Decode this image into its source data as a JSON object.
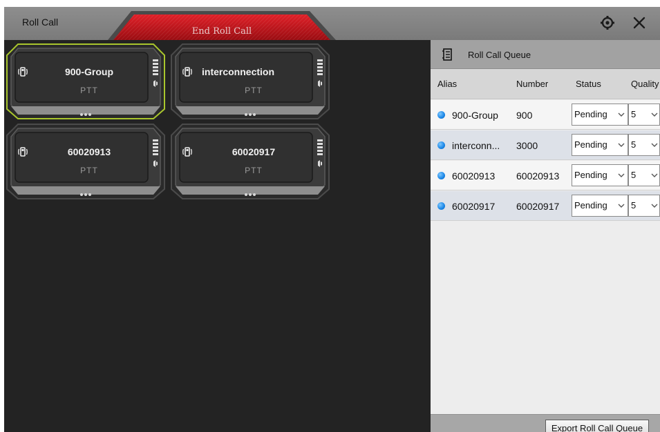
{
  "window": {
    "title": "Roll Call",
    "end_button_label": "End Roll Call",
    "settings_icon": "settings-gear-icon",
    "close_icon": "close-icon"
  },
  "cards": [
    {
      "name": "900-Group",
      "type": "PTT",
      "selected": true,
      "icon": "walkie-talkie-icon"
    },
    {
      "name": "interconnection",
      "type": "PTT",
      "selected": false,
      "icon": "walkie-talkie-icon"
    },
    {
      "name": "60020913",
      "type": "PTT",
      "selected": false,
      "icon": "walkie-talkie-icon"
    },
    {
      "name": "60020917",
      "type": "PTT",
      "selected": false,
      "icon": "walkie-talkie-icon"
    }
  ],
  "queue": {
    "title": "Roll Call Queue",
    "icon": "list-icon",
    "columns": [
      "Alias",
      "Number",
      "Status",
      "Quality"
    ],
    "rows": [
      {
        "alias": "900-Group",
        "number": "900",
        "status": "Pending",
        "quality": "5"
      },
      {
        "alias": "interconn...",
        "number": "3000",
        "status": "Pending",
        "quality": "5"
      },
      {
        "alias": "60020913",
        "number": "60020913",
        "status": "Pending",
        "quality": "5"
      },
      {
        "alias": "60020917",
        "number": "60020917",
        "status": "Pending",
        "quality": "5"
      }
    ],
    "export_label": "Export Roll Call Queue"
  },
  "colors": {
    "accent_red": "#c8151c",
    "selected_outline": "#a9c62d",
    "status_dot": "#1a86e6"
  }
}
